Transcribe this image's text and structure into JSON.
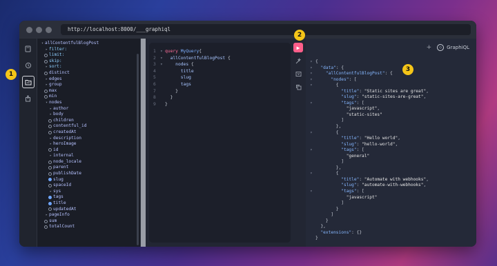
{
  "window": {
    "url": "http://localhost:8000/___graphiql"
  },
  "badges": [
    "1",
    "2",
    "3"
  ],
  "rail": {
    "icons": [
      "file-icon",
      "history-icon",
      "explorer-icon",
      "share-icon"
    ]
  },
  "explorer": {
    "rows": [
      {
        "mk": "▾",
        "cb": "",
        "text": "allContentfulBlogPost",
        "cls": "",
        "indent": 0
      },
      {
        "mk": "▸",
        "cb": "",
        "text": "filter:",
        "cls": "arg",
        "indent": 1
      },
      {
        "mk": "",
        "cb": "off",
        "text": "limit:",
        "cls": "arg",
        "indent": 1
      },
      {
        "mk": "",
        "cb": "off",
        "text": "skip:",
        "cls": "arg",
        "indent": 1
      },
      {
        "mk": "▸",
        "cb": "",
        "text": "sort:",
        "cls": "arg",
        "indent": 1
      },
      {
        "mk": "",
        "cb": "off",
        "text": "distinct",
        "cls": "",
        "indent": 1
      },
      {
        "mk": "▸",
        "cb": "",
        "text": "edges",
        "cls": "",
        "indent": 1
      },
      {
        "mk": "▸",
        "cb": "",
        "text": "group",
        "cls": "",
        "indent": 1
      },
      {
        "mk": "",
        "cb": "off",
        "text": "max",
        "cls": "",
        "indent": 1
      },
      {
        "mk": "",
        "cb": "off",
        "text": "min",
        "cls": "",
        "indent": 1
      },
      {
        "mk": "▾",
        "cb": "",
        "text": "nodes",
        "cls": "",
        "indent": 1
      },
      {
        "mk": "▸",
        "cb": "",
        "text": "author",
        "cls": "",
        "indent": 2
      },
      {
        "mk": "▸",
        "cb": "",
        "text": "body",
        "cls": "",
        "indent": 2
      },
      {
        "mk": "",
        "cb": "off",
        "text": "children",
        "cls": "",
        "indent": 2
      },
      {
        "mk": "",
        "cb": "off",
        "text": "contentful_id",
        "cls": "",
        "indent": 2
      },
      {
        "mk": "",
        "cb": "off",
        "text": "createdAt",
        "cls": "",
        "indent": 2
      },
      {
        "mk": "▸",
        "cb": "",
        "text": "description",
        "cls": "",
        "indent": 2
      },
      {
        "mk": "▸",
        "cb": "",
        "text": "heroImage",
        "cls": "",
        "indent": 2
      },
      {
        "mk": "",
        "cb": "off",
        "text": "id",
        "cls": "",
        "indent": 2
      },
      {
        "mk": "▸",
        "cb": "",
        "text": "internal",
        "cls": "",
        "indent": 2
      },
      {
        "mk": "",
        "cb": "off",
        "text": "node_locale",
        "cls": "",
        "indent": 2
      },
      {
        "mk": "",
        "cb": "off",
        "text": "parent",
        "cls": "",
        "indent": 2
      },
      {
        "mk": "",
        "cb": "off",
        "text": "publishDate",
        "cls": "",
        "indent": 2
      },
      {
        "mk": "",
        "cb": "on",
        "text": "slug",
        "cls": "",
        "indent": 2
      },
      {
        "mk": "",
        "cb": "off",
        "text": "spaceId",
        "cls": "",
        "indent": 2
      },
      {
        "mk": "▸",
        "cb": "",
        "text": "sys",
        "cls": "",
        "indent": 2
      },
      {
        "mk": "",
        "cb": "on",
        "text": "tags",
        "cls": "",
        "indent": 2
      },
      {
        "mk": "",
        "cb": "on",
        "text": "title",
        "cls": "",
        "indent": 2
      },
      {
        "mk": "",
        "cb": "off",
        "text": "updatedAt",
        "cls": "",
        "indent": 2
      },
      {
        "mk": "▸",
        "cb": "",
        "text": "pageInfo",
        "cls": "",
        "indent": 1
      },
      {
        "mk": "",
        "cb": "off",
        "text": "sum",
        "cls": "",
        "indent": 1
      },
      {
        "mk": "",
        "cb": "off",
        "text": "totalCount",
        "cls": "",
        "indent": 1
      }
    ]
  },
  "editor": {
    "lines": [
      {
        "n": "1",
        "fold": "▾",
        "parts": [
          [
            "kw",
            "query "
          ],
          [
            "fn",
            "MyQuery"
          ],
          [
            "",
            "{"
          ]
        ]
      },
      {
        "n": "2",
        "fold": "▾",
        "parts": [
          [
            "",
            "  "
          ],
          [
            "fld",
            "allContentfulBlogPost"
          ],
          [
            "",
            " {"
          ]
        ]
      },
      {
        "n": "3",
        "fold": "▾",
        "parts": [
          [
            "",
            "    "
          ],
          [
            "fld",
            "nodes"
          ],
          [
            "",
            " {"
          ]
        ]
      },
      {
        "n": "4",
        "fold": "",
        "parts": [
          [
            "",
            "      "
          ],
          [
            "fld",
            "title"
          ]
        ]
      },
      {
        "n": "5",
        "fold": "",
        "parts": [
          [
            "",
            "      "
          ],
          [
            "fld",
            "slug"
          ]
        ]
      },
      {
        "n": "6",
        "fold": "",
        "parts": [
          [
            "",
            "      "
          ],
          [
            "fld",
            "tags"
          ]
        ]
      },
      {
        "n": "7",
        "fold": "",
        "parts": [
          [
            "",
            "    }"
          ]
        ]
      },
      {
        "n": "8",
        "fold": "",
        "parts": [
          [
            "",
            "  }"
          ]
        ]
      },
      {
        "n": "9",
        "fold": "",
        "parts": [
          [
            "",
            "}"
          ]
        ]
      }
    ]
  },
  "toolbar": {
    "run": "▶",
    "icons": [
      "prettify-icon",
      "merge-icon",
      "copy-icon"
    ]
  },
  "result_header": {
    "plus": "+",
    "brand": "GraphiQL"
  },
  "result": {
    "lines": [
      [
        "▾",
        [
          [
            "",
            "{"
          ]
        ]
      ],
      [
        "▾",
        [
          [
            "key",
            "  \"data\""
          ],
          [
            "",
            ": {"
          ]
        ]
      ],
      [
        "▾",
        [
          [
            "key",
            "    \"allContentfulBlogPost\""
          ],
          [
            "",
            ": {"
          ]
        ]
      ],
      [
        "▾",
        [
          [
            "key",
            "      \"nodes\""
          ],
          [
            "",
            ": ["
          ]
        ]
      ],
      [
        "▾",
        [
          [
            "",
            "        {"
          ]
        ]
      ],
      [
        "",
        [
          [
            "key",
            "          \"title\""
          ],
          [
            "",
            ": "
          ],
          [
            "str",
            "\"Static sites are great\""
          ],
          [
            "",
            ","
          ]
        ]
      ],
      [
        "",
        [
          [
            "key",
            "          \"slug\""
          ],
          [
            "",
            ": "
          ],
          [
            "str",
            "\"static-sites-are-great\""
          ],
          [
            "",
            ","
          ]
        ]
      ],
      [
        "▾",
        [
          [
            "key",
            "          \"tags\""
          ],
          [
            "",
            ": ["
          ]
        ]
      ],
      [
        "",
        [
          [
            "str",
            "            \"javascript\""
          ],
          [
            "",
            ","
          ]
        ]
      ],
      [
        "",
        [
          [
            "str",
            "            \"static-sites\""
          ]
        ]
      ],
      [
        "",
        [
          [
            "",
            "          ]"
          ]
        ]
      ],
      [
        "",
        [
          [
            "",
            "        },"
          ]
        ]
      ],
      [
        "▾",
        [
          [
            "",
            "        {"
          ]
        ]
      ],
      [
        "",
        [
          [
            "key",
            "          \"title\""
          ],
          [
            "",
            ": "
          ],
          [
            "str",
            "\"Hello world\""
          ],
          [
            "",
            ","
          ]
        ]
      ],
      [
        "",
        [
          [
            "key",
            "          \"slug\""
          ],
          [
            "",
            ": "
          ],
          [
            "str",
            "\"hello-world\""
          ],
          [
            "",
            ","
          ]
        ]
      ],
      [
        "▾",
        [
          [
            "key",
            "          \"tags\""
          ],
          [
            "",
            ": ["
          ]
        ]
      ],
      [
        "",
        [
          [
            "str",
            "            \"general\""
          ]
        ]
      ],
      [
        "",
        [
          [
            "",
            "          ]"
          ]
        ]
      ],
      [
        "",
        [
          [
            "",
            "        },"
          ]
        ]
      ],
      [
        "▾",
        [
          [
            "",
            "        {"
          ]
        ]
      ],
      [
        "",
        [
          [
            "key",
            "          \"title\""
          ],
          [
            "",
            ": "
          ],
          [
            "str",
            "\"Automate with webhooks\""
          ],
          [
            "",
            ","
          ]
        ]
      ],
      [
        "",
        [
          [
            "key",
            "          \"slug\""
          ],
          [
            "",
            ": "
          ],
          [
            "str",
            "\"automate-with-webhooks\""
          ],
          [
            "",
            ","
          ]
        ]
      ],
      [
        "▾",
        [
          [
            "key",
            "          \"tags\""
          ],
          [
            "",
            ": ["
          ]
        ]
      ],
      [
        "",
        [
          [
            "str",
            "            \"javascript\""
          ]
        ]
      ],
      [
        "",
        [
          [
            "",
            "          ]"
          ]
        ]
      ],
      [
        "",
        [
          [
            "",
            "        }"
          ]
        ]
      ],
      [
        "",
        [
          [
            "",
            "      ]"
          ]
        ]
      ],
      [
        "",
        [
          [
            "",
            "    }"
          ]
        ]
      ],
      [
        "",
        [
          [
            "",
            "  },"
          ]
        ]
      ],
      [
        "",
        [
          [
            "key",
            "  \"extensions\""
          ],
          [
            "",
            ": {}"
          ]
        ]
      ],
      [
        "",
        [
          [
            "",
            "}"
          ]
        ]
      ]
    ]
  }
}
